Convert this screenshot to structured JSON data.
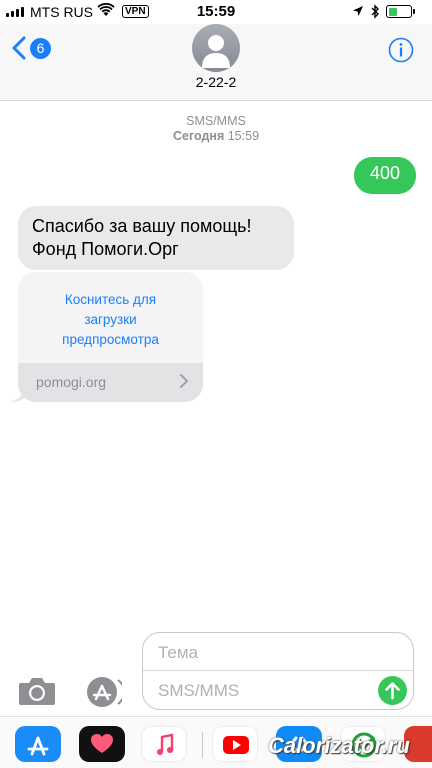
{
  "status_bar": {
    "carrier": "MTS RUS",
    "vpn": "VPN",
    "time": "15:59",
    "battery_percent": 40
  },
  "header": {
    "unread_count": "6",
    "contact": "2-22-2"
  },
  "conversation": {
    "service": "SMS/MMS",
    "date_day": "Сегодня",
    "date_time": "15:59",
    "messages": [
      {
        "direction": "outgoing",
        "text": "400"
      },
      {
        "direction": "incoming",
        "line1": "Спасибо за вашу помощь!",
        "line2": "Фонд Помоги.Орг"
      }
    ],
    "link_preview": {
      "line1": "Коснитесь для",
      "line2": "загрузки",
      "line3": "предпросмотра",
      "domain": "pomogi.org"
    }
  },
  "composer": {
    "subject_placeholder": "Тема",
    "body_placeholder": "SMS/MMS"
  },
  "app_drawer": {
    "apps": [
      "app-store-icon",
      "digital-touch-icon",
      "music-icon",
      "youtube-icon",
      "shazam-icon",
      "sberbank-icon"
    ]
  },
  "watermark": "Calorizator.ru",
  "colors": {
    "accent_blue": "#1a7ff6",
    "imessage_green": "#35c759",
    "incoming_bubble": "#e9e9eb"
  }
}
